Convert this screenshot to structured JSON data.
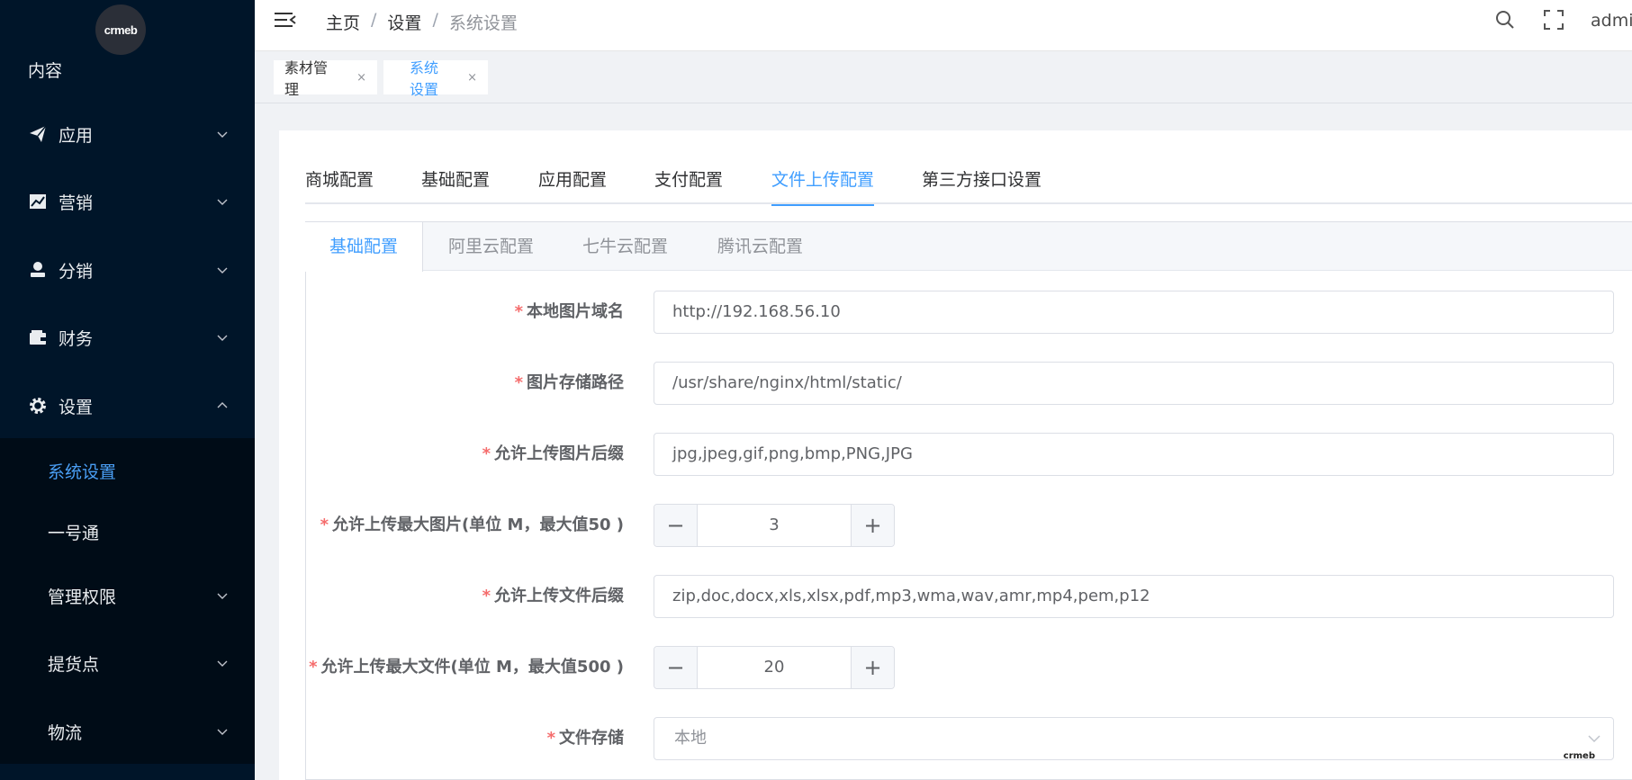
{
  "logo": {
    "text": "crmeb"
  },
  "sidebar": {
    "partial_item": "内容",
    "items": [
      {
        "label": "应用",
        "icon": "send-icon"
      },
      {
        "label": "营销",
        "icon": "chart-icon"
      },
      {
        "label": "分销",
        "icon": "user-icon"
      },
      {
        "label": "财务",
        "icon": "wallet-icon"
      },
      {
        "label": "设置",
        "icon": "gear-icon"
      }
    ],
    "sub_items": [
      {
        "label": "系统设置"
      },
      {
        "label": "一号通"
      },
      {
        "label": "管理权限"
      },
      {
        "label": "提货点"
      },
      {
        "label": "物流"
      }
    ]
  },
  "header": {
    "breadcrumb": [
      "主页",
      "设置",
      "系统设置"
    ],
    "separator": "/",
    "user": "admin"
  },
  "tags": [
    {
      "label": "素材管理",
      "close": "×"
    },
    {
      "label": "系统设置",
      "close": "×"
    }
  ],
  "top_tabs": [
    "商城配置",
    "基础配置",
    "应用配置",
    "支付配置",
    "文件上传配置",
    "第三方接口设置"
  ],
  "inner_tabs": [
    "基础配置",
    "阿里云配置",
    "七牛云配置",
    "腾讯云配置"
  ],
  "form": {
    "required_mark": "*",
    "local_domain": {
      "label": "本地图片域名",
      "value": "http://192.168.56.10"
    },
    "storage_path": {
      "label": "图片存储路径",
      "value": "/usr/share/nginx/html/static/"
    },
    "image_ext": {
      "label": "允许上传图片后缀",
      "value": "jpg,jpeg,gif,png,bmp,PNG,JPG"
    },
    "image_max": {
      "label": "允许上传最大图片(单位 M，最大值50 )",
      "value": "3",
      "minus": "−",
      "plus": "+"
    },
    "file_ext": {
      "label": "允许上传文件后缀",
      "value": "zip,doc,docx,xls,xlsx,pdf,mp3,wma,wav,amr,mp4,pem,p12"
    },
    "file_max": {
      "label": "允许上传最大文件(单位 M，最大值500 )",
      "value": "20",
      "minus": "−",
      "plus": "+"
    },
    "file_storage": {
      "label": "文件存储",
      "value": "本地"
    }
  },
  "watermark": "crmeb",
  "colors": {
    "sidebar_bg": "#001529",
    "accent": "#409eff",
    "required": "#f56c6c"
  }
}
